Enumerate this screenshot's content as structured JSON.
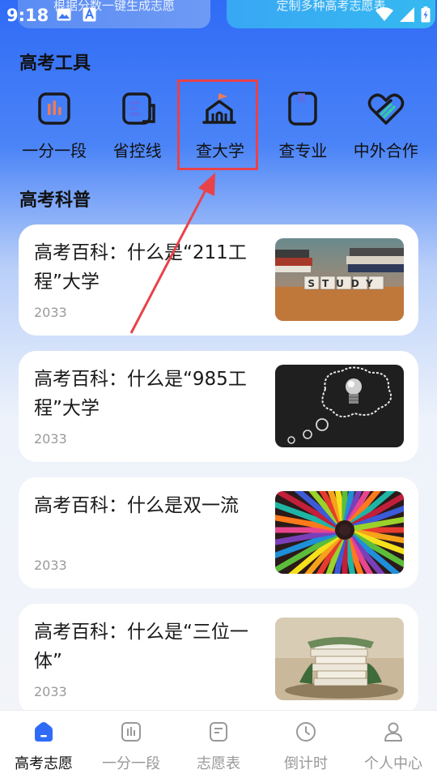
{
  "status_bar": {
    "time": "9:18",
    "icons": [
      "image-icon",
      "a-text-icon",
      "wifi-icon",
      "signal-icon",
      "battery-icon"
    ]
  },
  "banners": [
    {
      "text": "根据分数一键生成志愿"
    },
    {
      "text": "定制多种高考志愿表"
    }
  ],
  "tools_section": {
    "title": "高考工具",
    "items": [
      {
        "label": "一分一段",
        "icon": "bar-chart-icon"
      },
      {
        "label": "省控线",
        "icon": "document-icon"
      },
      {
        "label": "查大学",
        "icon": "university-icon"
      },
      {
        "label": "查专业",
        "icon": "bookmark-book-icon"
      },
      {
        "label": "中外合作",
        "icon": "handshake-heart-icon"
      }
    ],
    "highlighted_item": "查大学"
  },
  "science_section": {
    "title": "高考科普",
    "articles": [
      {
        "title": "高考百科：什么是“211工程”大学",
        "year": "2033",
        "thumb_word": "STUDY"
      },
      {
        "title": "高考百科：什么是“985工程”大学",
        "year": "2033"
      },
      {
        "title": "高考百科：什么是双一流",
        "year": "2033"
      },
      {
        "title": "高考百科：什么是“三位一体”",
        "year": "2033"
      }
    ]
  },
  "bottom_nav": {
    "items": [
      {
        "label": "高考志愿",
        "icon": "home-icon",
        "active": true
      },
      {
        "label": "一分一段",
        "icon": "bar-chart-icon",
        "active": false
      },
      {
        "label": "志愿表",
        "icon": "list-icon",
        "active": false
      },
      {
        "label": "倒计时",
        "icon": "clock-icon",
        "active": false
      },
      {
        "label": "个人中心",
        "icon": "user-icon",
        "active": false
      }
    ]
  },
  "colors": {
    "primary": "#2f6bf6",
    "highlight": "#e8424a",
    "accent_orange": "#f07b52"
  }
}
